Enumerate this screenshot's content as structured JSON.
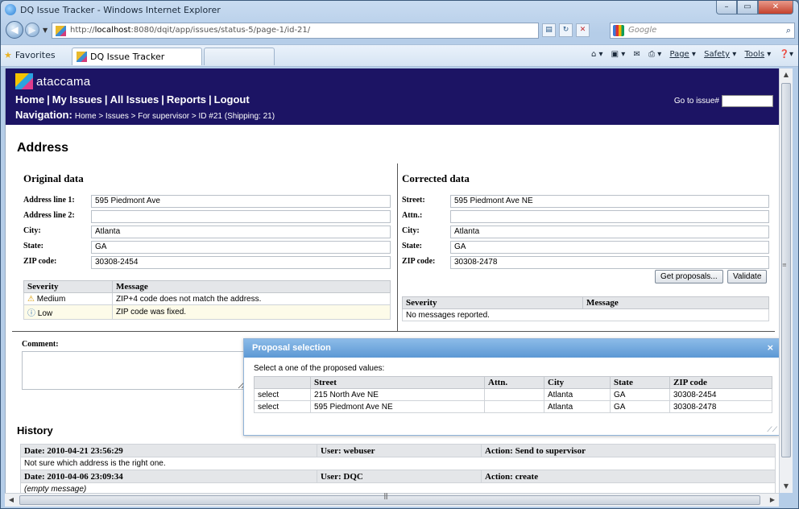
{
  "window": {
    "title": "DQ Issue Tracker - Windows Internet Explorer",
    "url_prefix": "http://",
    "url_host": "localhost",
    "url_rest": ":8080/dqit/app/issues/status-5/page-1/id-21/",
    "search_placeholder": "Google",
    "favorites_label": "Favorites",
    "tab_label": "DQ Issue Tracker",
    "cmd": {
      "page": "Page",
      "safety": "Safety",
      "tools": "Tools"
    }
  },
  "header": {
    "logo_text": "ataccama",
    "nav": [
      "Home",
      "My Issues",
      "All Issues",
      "Reports",
      "Logout"
    ],
    "nav_sep": "|",
    "breadcrumb_label": "Navigation:",
    "breadcrumb_path": "Home > Issues > For supervisor > ID #21 (Shipping: 21)",
    "goto_label": "Go to issue#"
  },
  "page": {
    "title": "Address"
  },
  "original": {
    "title": "Original data",
    "fields": [
      {
        "label": "Address line 1:",
        "value": "595 Piedmont Ave"
      },
      {
        "label": "Address line 2:",
        "value": ""
      },
      {
        "label": "City:",
        "value": "Atlanta"
      },
      {
        "label": "State:",
        "value": "GA"
      },
      {
        "label": "ZIP code:",
        "value": "30308-2454"
      }
    ],
    "messages_header": {
      "severity": "Severity",
      "message": "Message"
    },
    "messages": [
      {
        "severity": "Medium",
        "message": "ZIP+4 code does not match the address.",
        "icon": "warning-icon"
      },
      {
        "severity": "Low",
        "message": "ZIP code was fixed.",
        "icon": "info-icon"
      }
    ]
  },
  "corrected": {
    "title": "Corrected data",
    "fields": [
      {
        "label": "Street:",
        "value": "595 Piedmont Ave NE"
      },
      {
        "label": "Attn.:",
        "value": ""
      },
      {
        "label": "City:",
        "value": "Atlanta"
      },
      {
        "label": "State:",
        "value": "GA"
      },
      {
        "label": "ZIP code:",
        "value": "30308-2478"
      }
    ],
    "get_proposals_label": "Get proposals...",
    "validate_label": "Validate",
    "messages_header": {
      "severity": "Severity",
      "message": "Message"
    },
    "no_messages": "No messages reported."
  },
  "comment": {
    "label": "Comment:"
  },
  "dialog": {
    "title": "Proposal selection",
    "close": "×",
    "prompt": "Select a one of the proposed values:",
    "columns": [
      "Street",
      "Attn.",
      "City",
      "State",
      "ZIP code"
    ],
    "rows": [
      {
        "action": "select",
        "street": "215 North Ave NE",
        "attn": "",
        "city": "Atlanta",
        "state": "GA",
        "zip": "30308-2454"
      },
      {
        "action": "select",
        "street": "595 Piedmont Ave NE",
        "attn": "",
        "city": "Atlanta",
        "state": "GA",
        "zip": "30308-2478"
      }
    ]
  },
  "history": {
    "title": "History",
    "entries": [
      {
        "date": "Date: 2010-04-21 23:56:29",
        "user": "User: webuser",
        "action": "Action: Send to supervisor",
        "message": "Not sure which address is the right one."
      },
      {
        "date": "Date: 2010-04-06 23:09:34",
        "user": "User: DQC",
        "action": "Action: create",
        "message": "(empty message)"
      }
    ]
  },
  "colors": {
    "header_bg": "#1c1464",
    "dialog_title": "#5c98d4",
    "grid_header": "#e4e6e9"
  }
}
